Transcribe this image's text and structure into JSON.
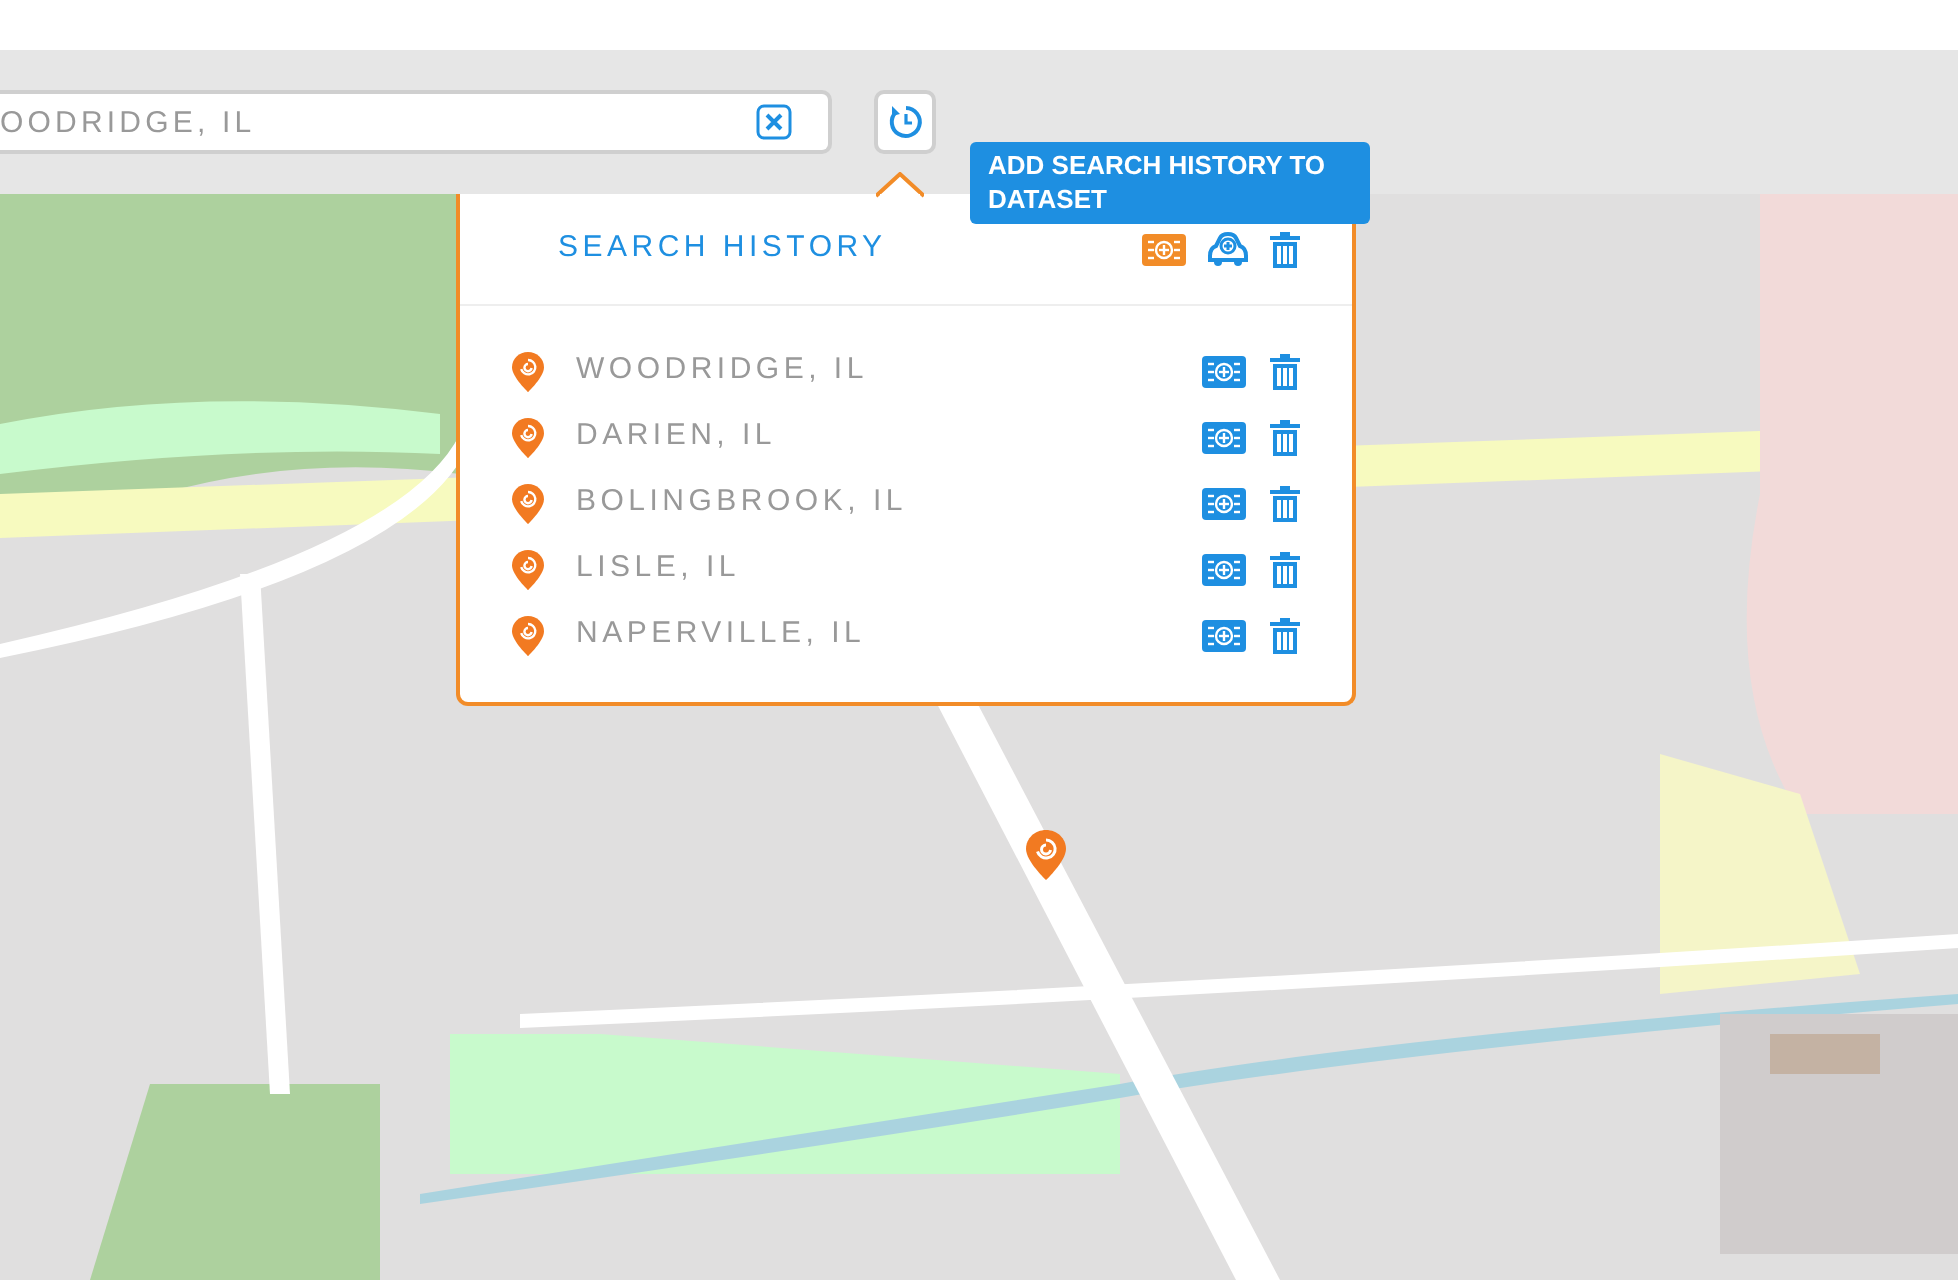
{
  "search": {
    "value": "OODRIDGE, IL"
  },
  "tooltip": {
    "text": "ADD SEARCH HISTORY TO DATASET"
  },
  "popup": {
    "title": "SEARCH HISTORY",
    "actions": [
      {
        "kind": "dataset",
        "highlighted": true
      },
      {
        "kind": "route",
        "highlighted": false
      },
      {
        "kind": "delete",
        "highlighted": false
      }
    ],
    "items": [
      {
        "label": "WOODRIDGE, IL"
      },
      {
        "label": "DARIEN, IL"
      },
      {
        "label": "BOLINGBROOK, IL"
      },
      {
        "label": "LISLE, IL"
      },
      {
        "label": "NAPERVILLE, IL"
      }
    ]
  }
}
